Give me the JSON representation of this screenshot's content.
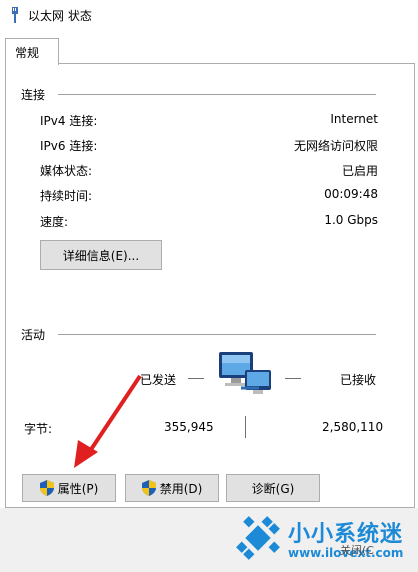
{
  "window": {
    "title": "以太网 状态"
  },
  "tabs": [
    {
      "label": "常规"
    }
  ],
  "connection": {
    "section_label": "连接",
    "rows": [
      {
        "label": "IPv4 连接:",
        "value": "Internet"
      },
      {
        "label": "IPv6 连接:",
        "value": "无网络访问权限"
      },
      {
        "label": "媒体状态:",
        "value": "已启用"
      },
      {
        "label": "持续时间:",
        "value": "00:09:48"
      },
      {
        "label": "速度:",
        "value": "1.0 Gbps"
      }
    ],
    "details_button": "详细信息(E)..."
  },
  "activity": {
    "section_label": "活动",
    "sent_label": "已发送",
    "received_label": "已接收",
    "bytes_label": "字节:",
    "bytes_sent": "355,945",
    "bytes_received": "2,580,110"
  },
  "buttons": {
    "properties": "属性(P)",
    "disable": "禁用(D)",
    "diagnose": "诊断(G)"
  },
  "watermark": {
    "brand": "小小系统迷",
    "url": "www.ilovext.com",
    "partial_text": "关闭(C"
  },
  "colors": {
    "accent_blue": "#1c8ad6",
    "arrow_red": "#e02020",
    "button_bg": "#e1e1e1",
    "shield_blue": "#1f5fb5",
    "shield_yellow": "#f2c31b"
  }
}
